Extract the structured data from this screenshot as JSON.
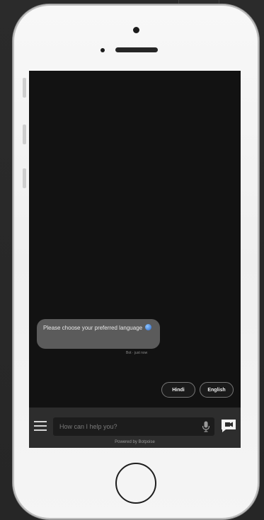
{
  "chat": {
    "bot_message": "Please choose your preferred language",
    "bot_emoji": "globe-emoji",
    "message_meta": "Bot · just now"
  },
  "quick_replies": [
    {
      "label": "Hindi"
    },
    {
      "label": "English"
    }
  ],
  "composer": {
    "placeholder": "How can I help you?",
    "powered_by": "Powered by Botpoise"
  },
  "icons": {
    "menu": "hamburger-menu-icon",
    "mic": "microphone-icon",
    "send": "chat-send-icon"
  },
  "colors": {
    "screen_bg": "#121212",
    "bubble_bg": "#5b5b5b",
    "composer_bg": "#2d2d2d",
    "phone_body": "#f5f5f5"
  }
}
